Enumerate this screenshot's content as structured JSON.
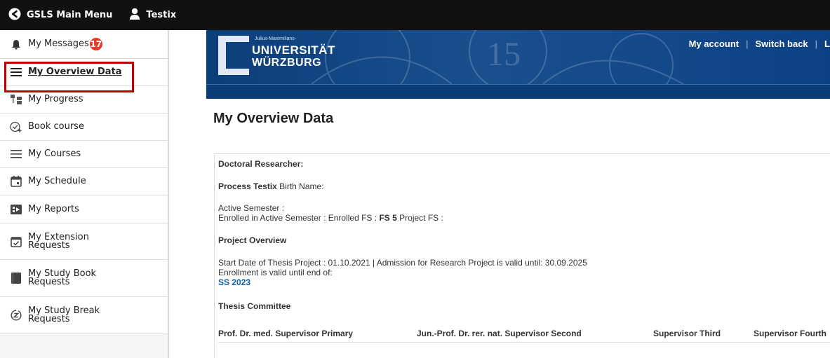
{
  "topbar": {
    "menu_label": "GSLS Main Menu",
    "user_label": "Testix"
  },
  "sidebar": {
    "items": [
      {
        "label": "My Messages",
        "badge": "17"
      },
      {
        "label": "My Overview Data"
      },
      {
        "label": "My Progress"
      },
      {
        "label": "Book course"
      },
      {
        "label": "My Courses"
      },
      {
        "label": "My Schedule"
      },
      {
        "label": "My Reports"
      },
      {
        "label": "My Extension Requests"
      },
      {
        "label": "My Study Book Requests"
      },
      {
        "label": "My Study Break Requests"
      }
    ]
  },
  "banner": {
    "logo_small": "Julius-Maximilians-",
    "logo_line1": "UNIVERSITÄT",
    "logo_line2": "WÜRZBURG",
    "links": [
      "My account",
      "Switch back",
      "L"
    ]
  },
  "main": {
    "title": "My Overview Data",
    "researcher_heading": "Doctoral Researcher:",
    "name": "Process Testix",
    "birth_name_label": "Birth Name:",
    "active_semester": "Active Semester :",
    "enrolled_prefix": "Enrolled in Active Semester : Enrolled FS :",
    "enrolled_fs": "FS 5",
    "project_fs": "Project FS :",
    "project_overview": "Project Overview",
    "start_date_line": "Start Date of Thesis Project : 01.10.2021 | Admission for Research Project is valid until: 30.09.2025",
    "enrollment_valid": "Enrollment is valid until end of:",
    "semester_link": "SS 2023",
    "committee_heading": "Thesis Committee",
    "committee": [
      "Prof. Dr. med. Supervisor Primary",
      "Jun.-Prof. Dr. rer. nat. Supervisor Second",
      "Supervisor Third",
      "Supervisor Fourth"
    ]
  },
  "colors": {
    "highlight": "#c00000",
    "badge": "#e53a2e",
    "banner": "#0c3e7a",
    "link": "#0b5ea8"
  }
}
